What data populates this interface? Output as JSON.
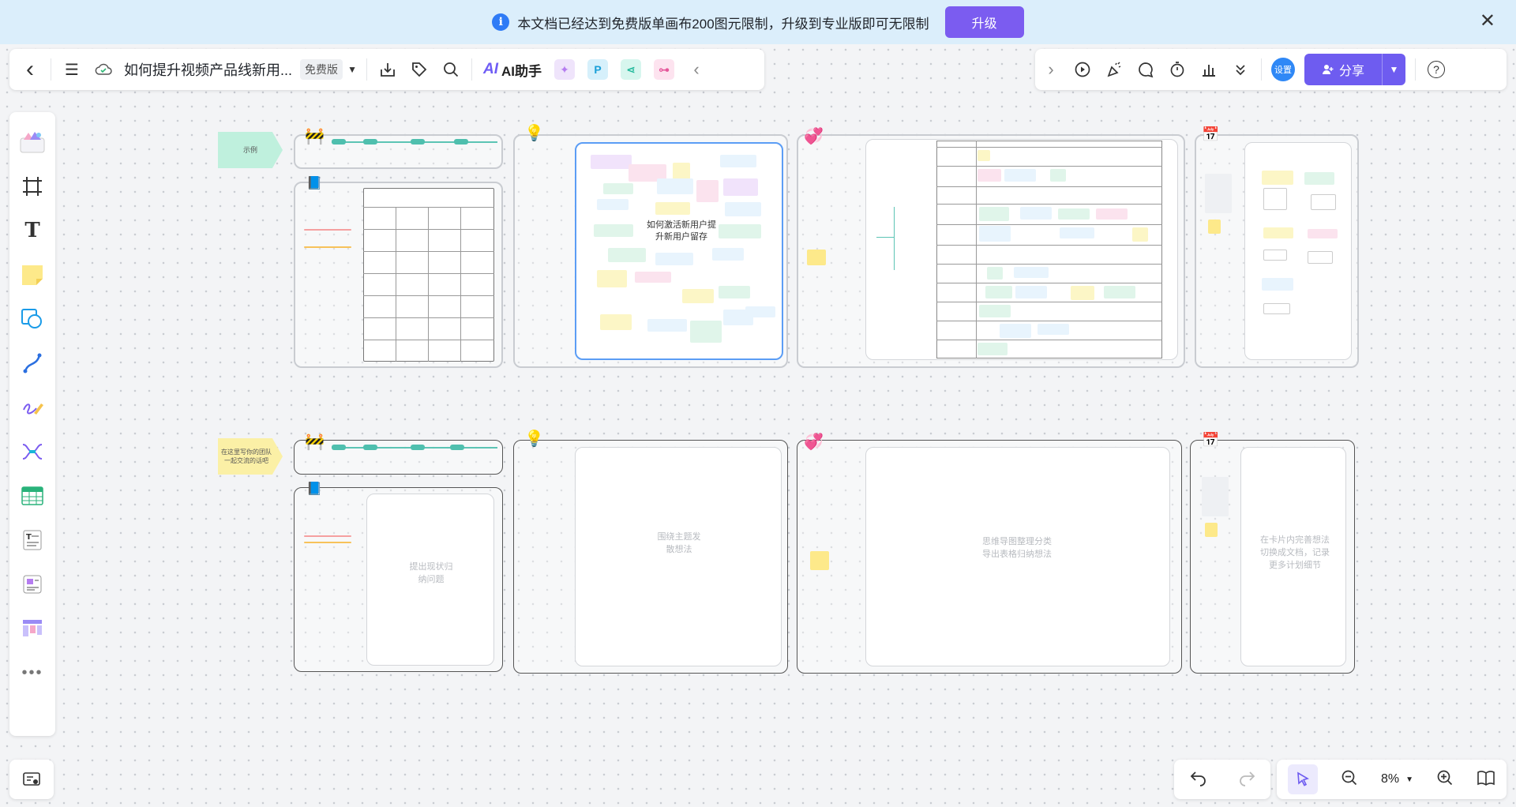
{
  "banner": {
    "message": "本文档已经达到免费版单画布200图元限制，升级到专业版即可无限制",
    "upgrade_label": "升级",
    "info_glyph": "i",
    "close_glyph": "✕"
  },
  "toolbar": {
    "back_glyph": "‹",
    "menu_glyph": "☰",
    "doc_title": "如何提升视频产品线新用...",
    "plan_badge": "免费版",
    "ai_label": "AI助手",
    "ai_logo": "AI",
    "plugin_p": "P",
    "collapse_glyph": "‹",
    "expand_glyph": "›",
    "settings_label": "设置",
    "share_label": "分享",
    "help_glyph": "?"
  },
  "canvas": {
    "row1_label": "示例",
    "row2_label": "在这里写你的团队一起交流的话吧",
    "center_topic": "如何激活新用户提升新用户留存",
    "placeholder_1": "提出现状归纳问题",
    "placeholder_2": "围绕主题发散想法",
    "placeholder_3": "思维导图整理分类导出表格归纳想法",
    "placeholder_4": "在卡片内完善想法切换成文档，记录更多计划细节"
  },
  "zoom": {
    "level": "8%"
  },
  "colors": {
    "accent": "#6e5cf0",
    "banner_bg": "#dbeefb",
    "teal": "#5cc4b4"
  }
}
